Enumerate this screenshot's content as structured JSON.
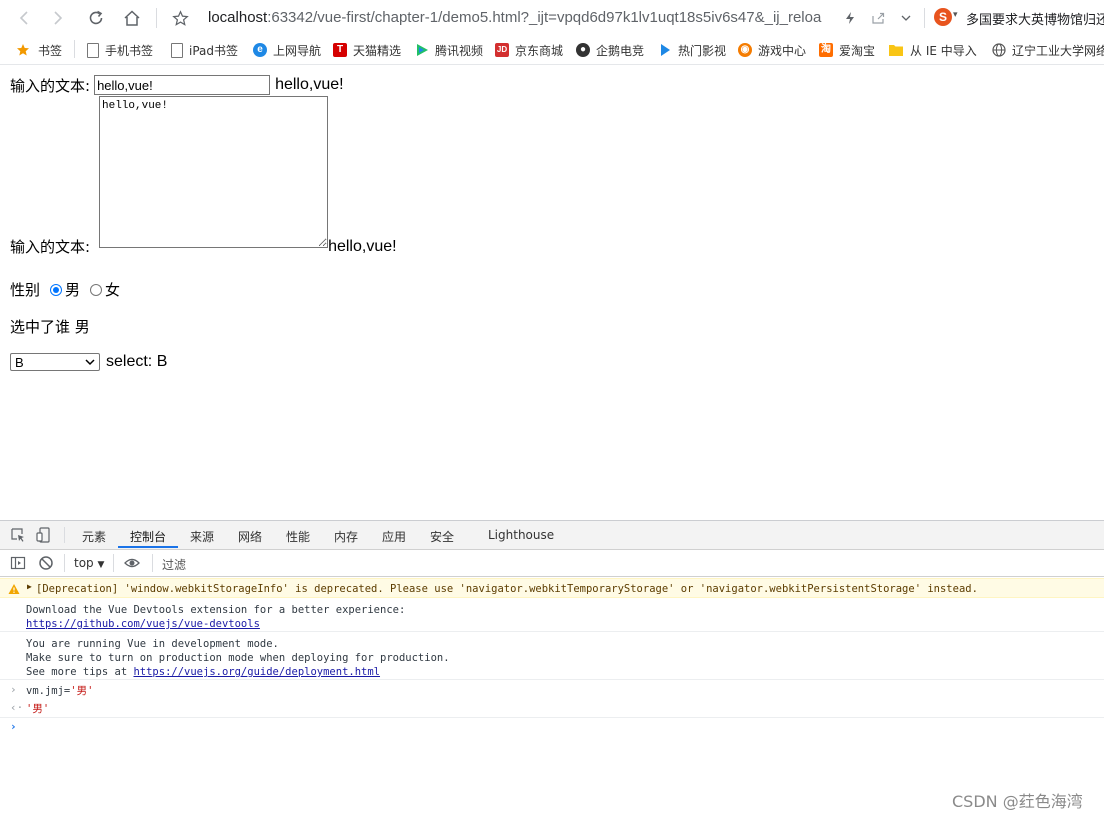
{
  "browser": {
    "address": {
      "host": "localhost",
      "rest": ":63342/vue-first/chapter-1/demo5.html?_ijt=vpqd6d97k1lv1uqt18s5iv6s47&_ij_reloa"
    },
    "news_text": "多国要求大英博物馆归还"
  },
  "bookmarks": [
    {
      "label": "书签",
      "icon": "star-icon",
      "color": "#f29900"
    },
    {
      "label": "手机书签",
      "icon": "phone-icon",
      "color": "#666666"
    },
    {
      "label": "iPad书签",
      "icon": "tablet-icon",
      "color": "#666666"
    },
    {
      "label": "上网导航",
      "icon": "ie-icon",
      "color": "#1e88e5"
    },
    {
      "label": "天猫精选",
      "icon": "tmall-icon",
      "color": "#d50000"
    },
    {
      "label": "腾讯视频",
      "icon": "tencent-video-icon",
      "color": "#21c065"
    },
    {
      "label": "京东商城",
      "icon": "jd-icon",
      "color": "#d32f2f"
    },
    {
      "label": "企鹅电竞",
      "icon": "penguin-icon",
      "color": "#333333"
    },
    {
      "label": "热门影视",
      "icon": "play-icon",
      "color": "#1e88e5"
    },
    {
      "label": "游戏中心",
      "icon": "gamepad-icon",
      "color": "#f57c00"
    },
    {
      "label": "爱淘宝",
      "icon": "taobao-icon",
      "color": "#ff6d00"
    },
    {
      "label": "从 IE 中导入",
      "icon": "folder-icon",
      "color": "#f9c515"
    },
    {
      "label": "辽宁工业大学网络",
      "icon": "globe-icon",
      "color": "#555555"
    }
  ],
  "page": {
    "input_label": "输入的文本:",
    "input_value": "hello,vue!",
    "input_echo": "hello,vue!",
    "textarea_label": "输入的文本:",
    "textarea_value": "hello,vue!",
    "textarea_echo": "hello,vue!",
    "gender_label": "性别",
    "radio_male": "男",
    "radio_female": "女",
    "radio_checked": "男",
    "selected_text": "选中了谁 男",
    "select_value": "B",
    "select_echo": "select: B"
  },
  "devtools": {
    "tabs": [
      "元素",
      "控制台",
      "来源",
      "网络",
      "性能",
      "内存",
      "应用",
      "安全",
      "Lighthouse"
    ],
    "active_tab": "控制台",
    "context": "top",
    "filter_placeholder": "过滤",
    "messages": {
      "warning": "[Deprecation] 'window.webkitStorageInfo' is deprecated. Please use 'navigator.webkitTemporaryStorage' or 'navigator.webkitPersistentStorage' instead.",
      "devtools_line": "Download the Vue Devtools extension for a better experience:",
      "devtools_link": "https://github.com/vuejs/vue-devtools",
      "dev_mode_1": "You are running Vue in development mode.",
      "dev_mode_2": "Make sure to turn on production mode when deploying for production.",
      "dev_mode_3": "See more tips at ",
      "dev_mode_link": "https://vuejs.org/guide/deployment.html",
      "command_prefix": "vm.jmj=",
      "command_value": "'男'",
      "result_value": "'男'"
    }
  },
  "watermark": "CSDN @荭色海湾"
}
